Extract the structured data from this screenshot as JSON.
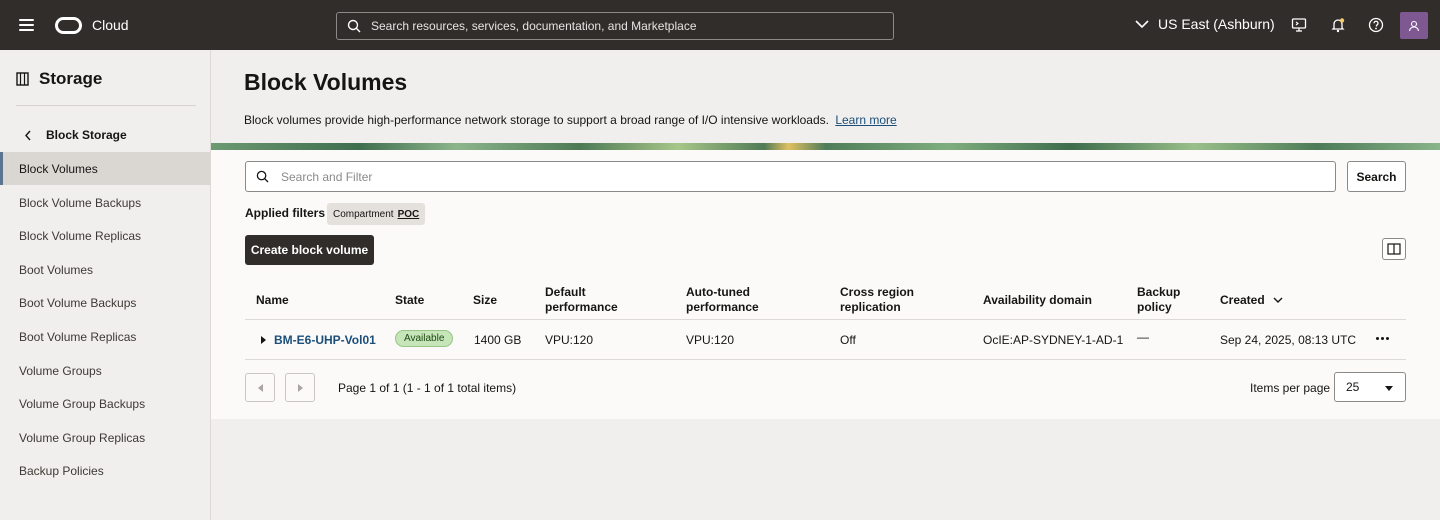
{
  "topbar": {
    "brand": "Cloud",
    "search_placeholder": "Search resources, services, documentation, and Marketplace",
    "region": "US East (Ashburn)",
    "icons": [
      "hamburger-icon",
      "oracle-logo",
      "search-icon",
      "chevron-down-icon",
      "cloud-shell-icon",
      "bell-icon",
      "help-icon",
      "user-icon"
    ]
  },
  "sidebar": {
    "title": "Storage",
    "back_label": "Block Storage",
    "items": [
      {
        "label": "Block Volumes",
        "active": true
      },
      {
        "label": "Block Volume Backups"
      },
      {
        "label": "Block Volume Replicas"
      },
      {
        "label": "Boot Volumes"
      },
      {
        "label": "Boot Volume Backups"
      },
      {
        "label": "Boot Volume Replicas"
      },
      {
        "label": "Volume Groups"
      },
      {
        "label": "Volume Group Backups"
      },
      {
        "label": "Volume Group Replicas"
      },
      {
        "label": "Backup Policies"
      }
    ]
  },
  "main": {
    "title": "Block Volumes",
    "description": "Block volumes provide high-performance network storage to support a broad range of I/O intensive workloads.",
    "learn_more": "Learn more",
    "filter_placeholder": "Search and Filter",
    "search_button": "Search",
    "applied_filters_label": "Applied filters",
    "chip": {
      "key": "Compartment",
      "value": "POC"
    },
    "create_button": "Create block volume"
  },
  "table": {
    "headers": {
      "name": "Name",
      "state": "State",
      "size": "Size",
      "default_perf_1": "Default",
      "default_perf_2": "performance",
      "auto_perf_1": "Auto-tuned",
      "auto_perf_2": "performance",
      "cross_1": "Cross region",
      "cross_2": "replication",
      "ad": "Availability domain",
      "backup_1": "Backup",
      "backup_2": "policy",
      "created": "Created"
    },
    "rows": [
      {
        "name": "BM-E6-UHP-Vol01",
        "state": "Available",
        "size": "1400 GB",
        "default_performance": "VPU:120",
        "auto_tuned_performance": "VPU:120",
        "cross_region_replication": "Off",
        "availability_domain": "OcIE:AP-SYDNEY-1-AD-1",
        "backup_policy": "—",
        "created": "Sep 24, 2025, 08:13 UTC"
      }
    ]
  },
  "pagination": {
    "text": "Page 1 of 1 (1 - 1 of 1 total items)",
    "items_per_page_label": "Items per page",
    "items_per_page": "25"
  },
  "colors": {
    "topbar": "#312d2a",
    "link": "#1b4e79",
    "badge": "#c6e5b8",
    "avatar": "#7e5890"
  }
}
